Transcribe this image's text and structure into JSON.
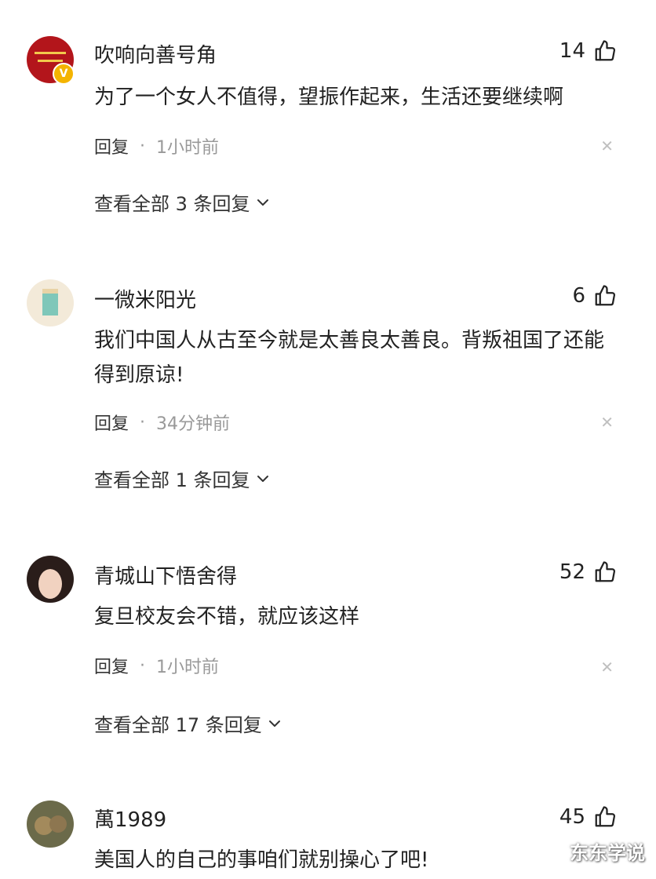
{
  "comments": [
    {
      "username": "吹响向善号角",
      "likes": "14",
      "text": "为了一个女人不值得，望振作起来，生活还要继续啊",
      "reply_label": "回复",
      "time": "1小时前",
      "view_all": "查看全部 3 条回复",
      "verified_badge": "V"
    },
    {
      "username": "一微米阳光",
      "likes": "6",
      "text": "我们中国人从古至今就是太善良太善良。背叛祖国了还能得到原谅!",
      "reply_label": "回复",
      "time": "34分钟前",
      "view_all": "查看全部 1 条回复"
    },
    {
      "username": "青城山下悟舍得",
      "likes": "52",
      "text": "复旦校友会不错，就应该这样",
      "reply_label": "回复",
      "time": "1小时前",
      "view_all": "查看全部 17 条回复"
    },
    {
      "username": "萬1989",
      "likes": "45",
      "text": "美国人的自己的事咱们就别操心了吧!"
    }
  ],
  "icons": {
    "like": "thumbs-up-icon",
    "close": "close-icon",
    "expand": "chevron-down-icon"
  },
  "colors": {
    "text_primary": "#222222",
    "text_secondary": "#999999",
    "badge": "#f4b400"
  },
  "watermark": "东东学说"
}
